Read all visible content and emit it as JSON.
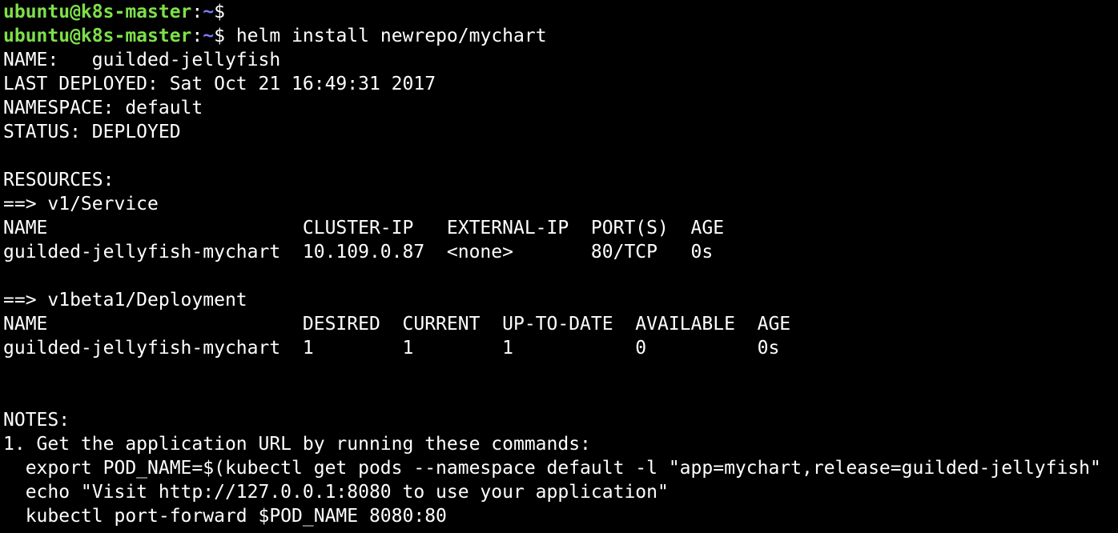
{
  "colors": {
    "background": "#000000",
    "foreground": "#ffffff",
    "prompt_user_host": "#7ee04a",
    "prompt_path": "#7b7bff"
  },
  "prompt": {
    "user_host": "ubuntu@k8s-master",
    "separator": ":",
    "path": "~",
    "symbol": "$"
  },
  "lines": [
    {
      "kind": "prompt",
      "command": ""
    },
    {
      "kind": "prompt",
      "command": " helm install newrepo/mychart"
    },
    {
      "kind": "text",
      "text": "NAME:   guilded-jellyfish"
    },
    {
      "kind": "text",
      "text": "LAST DEPLOYED: Sat Oct 21 16:49:31 2017"
    },
    {
      "kind": "text",
      "text": "NAMESPACE: default"
    },
    {
      "kind": "text",
      "text": "STATUS: DEPLOYED"
    },
    {
      "kind": "blank",
      "text": ""
    },
    {
      "kind": "text",
      "text": "RESOURCES:"
    },
    {
      "kind": "text",
      "text": "==> v1/Service"
    },
    {
      "kind": "text",
      "text": "NAME                       CLUSTER-IP   EXTERNAL-IP  PORT(S)  AGE"
    },
    {
      "kind": "text",
      "text": "guilded-jellyfish-mychart  10.109.0.87  <none>       80/TCP   0s"
    },
    {
      "kind": "blank",
      "text": ""
    },
    {
      "kind": "text",
      "text": "==> v1beta1/Deployment"
    },
    {
      "kind": "text",
      "text": "NAME                       DESIRED  CURRENT  UP-TO-DATE  AVAILABLE  AGE"
    },
    {
      "kind": "text",
      "text": "guilded-jellyfish-mychart  1        1        1           0          0s"
    },
    {
      "kind": "blank",
      "text": ""
    },
    {
      "kind": "blank",
      "text": ""
    },
    {
      "kind": "text",
      "text": "NOTES:"
    },
    {
      "kind": "text",
      "text": "1. Get the application URL by running these commands:"
    },
    {
      "kind": "text",
      "text": "  export POD_NAME=$(kubectl get pods --namespace default -l \"app=mychart,release=guilded-jellyfish\""
    },
    {
      "kind": "text",
      "text": "  echo \"Visit http://127.0.0.1:8080 to use your application\""
    },
    {
      "kind": "text",
      "text": "  kubectl port-forward $POD_NAME 8080:80"
    }
  ]
}
